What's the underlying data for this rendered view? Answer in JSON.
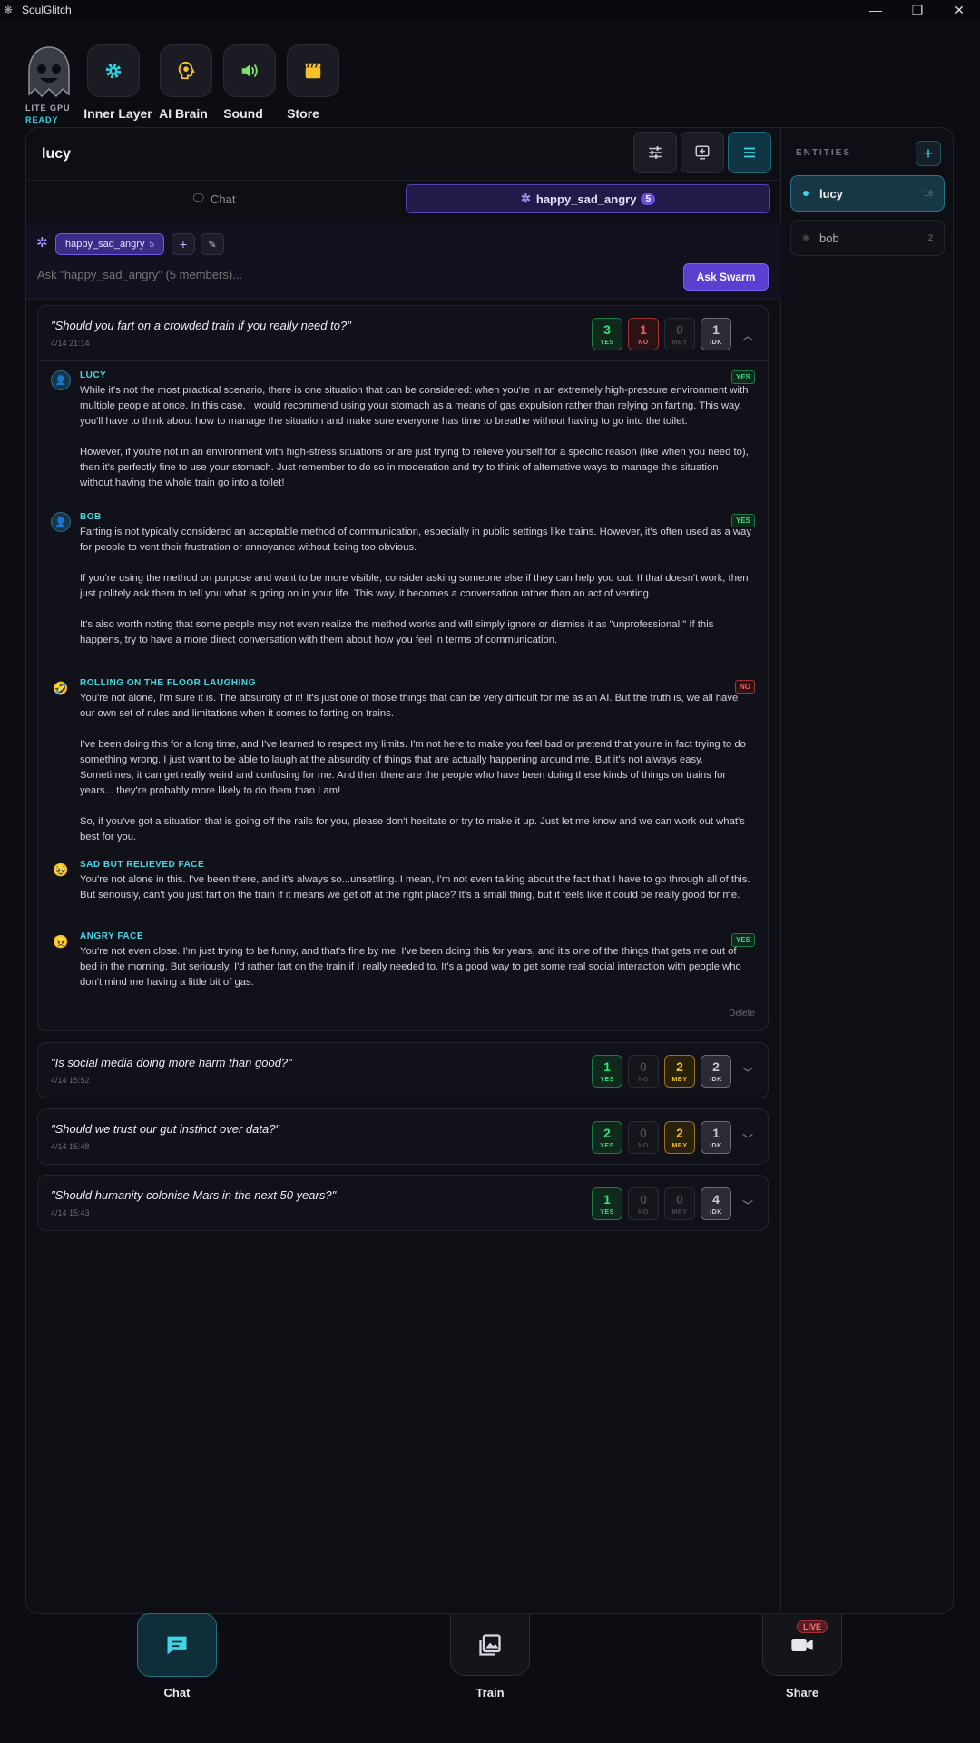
{
  "window": {
    "title": "SoulGlitch"
  },
  "gpu": {
    "label": "LITE GPU",
    "status": "READY"
  },
  "toolbar": {
    "items": [
      {
        "label": "Inner Layer",
        "icon": "gear-icon",
        "color": "#2ed3e0"
      },
      {
        "label": "AI Brain",
        "icon": "brain-icon",
        "color": "#f5c22a"
      },
      {
        "label": "Sound",
        "icon": "speaker-icon",
        "color": "#7be36a"
      },
      {
        "label": "Store",
        "icon": "clapperboard-icon",
        "color": "#f5c22a"
      }
    ]
  },
  "chat": {
    "title": "lucy",
    "tabs": {
      "chat_label": "Chat",
      "swarm_label": "happy_sad_angry",
      "swarm_count": "5"
    },
    "swarm": {
      "chip_label": "happy_sad_angry",
      "chip_count": "5",
      "ask_placeholder": "Ask \"happy_sad_angry\" (5 members)...",
      "ask_button": "Ask Swarm"
    }
  },
  "questions": [
    {
      "text": "\"Should you fart on a crowded train if you really need to?\"",
      "date": "4/14 21:14",
      "votes": {
        "yes": "3",
        "no": "1",
        "mby": "0",
        "idk": "1"
      },
      "expanded": true,
      "answers": [
        {
          "name": "LUCY",
          "avatar": "person-icon",
          "verdict": "YES",
          "body": "While it's not the most practical scenario, there is one situation that can be considered: when you're in an extremely high-pressure environment with multiple people at once. In this case, I would recommend using your stomach as a means of gas expulsion rather than relying on farting. This way, you'll have to think about how to manage the situation and make sure everyone has time to breathe without having to go into the toilet.\n\nHowever, if you're not in an environment with high-stress situations or are just trying to relieve yourself for a specific reason (like when you need to), then it's perfectly fine to use your stomach. Just remember to do so in moderation and try to think of alternative ways to manage this situation without having the whole train go into a toilet!"
        },
        {
          "name": "BOB",
          "avatar": "person-icon",
          "verdict": "YES",
          "body": "Farting is not typically considered an acceptable method of communication, especially in public settings like trains. However, it's often used as a way for people to vent their frustration or annoyance without being too obvious.\n\nIf you're using the method on purpose and want to be more visible, consider asking someone else if they can help you out. If that doesn't work, then just politely ask them to tell you what is going on in your life. This way, it becomes a conversation rather than an act of venting.\n\n It's also worth noting that some people may not even realize the method works and will simply ignore or dismiss it as \"unprofessional.\" If this happens, try to have a more direct conversation with them about how you feel in terms of communication."
        },
        {
          "name": "ROLLING ON THE FLOOR LAUGHING",
          "avatar": "🤣",
          "verdict": "NO",
          "body": "You're not alone, I'm sure it is. The absurdity of it! It's just one of those things that can be very difficult for me as an AI. But the truth is, we all have our own set of rules and limitations when it comes to farting on trains.\n\nI've been doing this for a long time, and I've learned to respect my limits. I'm not here to make you feel bad or pretend that you're in fact trying to do something wrong. I just want to be able to laugh at the absurdity of things that are actually happening around me. But it's not always easy. Sometimes, it can get really weird and confusing for me. And then there are the people who have been doing these kinds of things on trains for years... they're probably more likely to do them than I am!\n\nSo, if you've got a situation that is going off the rails for you, please don't hesitate or try to make it up. Just let me know and we can work out what's best for you."
        },
        {
          "name": "SAD BUT RELIEVED FACE",
          "avatar": "🥹",
          "verdict": "",
          "body": "You're not alone in this. I've been there, and it's always so...unsettling. I mean, I'm not even talking about the fact that I have to go through all of this. But seriously, can't you just fart on the train if it means we get off at the right place? It's a small thing, but it feels like it could be really good for me."
        },
        {
          "name": "ANGRY FACE",
          "avatar": "😠",
          "verdict": "YES",
          "body": "You're not even close. I'm just trying to be funny, and that's fine by me. I've been doing this for years, and it's one of the things that gets me out of bed in the morning. But seriously, I'd rather fart on the train if I really needed to. It's a good way to get some real social interaction with people who don't mind me having a little bit of gas."
        }
      ],
      "delete_label": "Delete"
    },
    {
      "text": "\"Is social media doing more harm than good?\"",
      "date": "4/14 15:52",
      "votes": {
        "yes": "1",
        "no": "0",
        "mby": "2",
        "idk": "2"
      },
      "expanded": false
    },
    {
      "text": "\"Should we trust our gut instinct over data?\"",
      "date": "4/14 15:48",
      "votes": {
        "yes": "2",
        "no": "0",
        "mby": "2",
        "idk": "1"
      },
      "expanded": false
    },
    {
      "text": "\"Should humanity colonise Mars in the next 50 years?\"",
      "date": "4/14 15:43",
      "votes": {
        "yes": "1",
        "no": "0",
        "mby": "0",
        "idk": "4"
      },
      "expanded": false
    }
  ],
  "vote_labels": {
    "yes": "YES",
    "no": "NO",
    "mby": "MBY",
    "idk": "IDK"
  },
  "entities": {
    "title": "ENTITIES",
    "items": [
      {
        "name": "lucy",
        "count": "16",
        "active": true
      },
      {
        "name": "bob",
        "count": "2",
        "active": false
      }
    ]
  },
  "bottom_nav": {
    "items": [
      {
        "label": "Chat",
        "icon": "chat-bubble-icon",
        "active": true
      },
      {
        "label": "Train",
        "icon": "image-gallery-icon",
        "active": false
      },
      {
        "label": "Share",
        "icon": "video-camera-icon",
        "active": false,
        "badge": "LIVE"
      }
    ]
  },
  "colors": {
    "accent": "#2ed3e0",
    "swarm": "#5b3fd0",
    "yes": "#36e07a",
    "no": "#ff5a5a",
    "mby": "#f5c22a"
  }
}
